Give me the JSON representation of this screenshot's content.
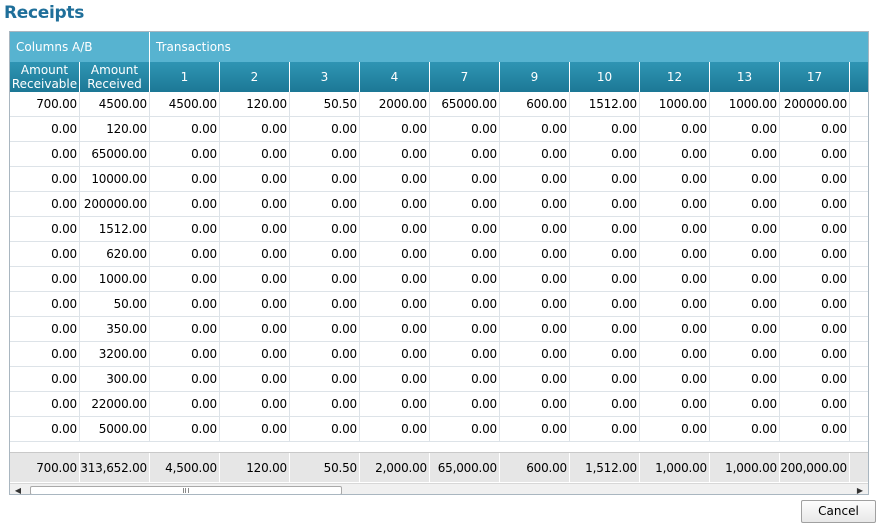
{
  "title": "Receipts",
  "bands": {
    "columns_ab": "Columns A/B",
    "transactions": "Transactions"
  },
  "headers": [
    "Amount Receivable",
    "Amount Received",
    "1",
    "2",
    "3",
    "4",
    "7",
    "9",
    "10",
    "12",
    "13",
    "17"
  ],
  "rows": [
    [
      "700.00",
      "4500.00",
      "4500.00",
      "120.00",
      "50.50",
      "2000.00",
      "65000.00",
      "600.00",
      "1512.00",
      "1000.00",
      "1000.00",
      "200000.00"
    ],
    [
      "0.00",
      "120.00",
      "0.00",
      "0.00",
      "0.00",
      "0.00",
      "0.00",
      "0.00",
      "0.00",
      "0.00",
      "0.00",
      "0.00"
    ],
    [
      "0.00",
      "65000.00",
      "0.00",
      "0.00",
      "0.00",
      "0.00",
      "0.00",
      "0.00",
      "0.00",
      "0.00",
      "0.00",
      "0.00"
    ],
    [
      "0.00",
      "10000.00",
      "0.00",
      "0.00",
      "0.00",
      "0.00",
      "0.00",
      "0.00",
      "0.00",
      "0.00",
      "0.00",
      "0.00"
    ],
    [
      "0.00",
      "200000.00",
      "0.00",
      "0.00",
      "0.00",
      "0.00",
      "0.00",
      "0.00",
      "0.00",
      "0.00",
      "0.00",
      "0.00"
    ],
    [
      "0.00",
      "1512.00",
      "0.00",
      "0.00",
      "0.00",
      "0.00",
      "0.00",
      "0.00",
      "0.00",
      "0.00",
      "0.00",
      "0.00"
    ],
    [
      "0.00",
      "620.00",
      "0.00",
      "0.00",
      "0.00",
      "0.00",
      "0.00",
      "0.00",
      "0.00",
      "0.00",
      "0.00",
      "0.00"
    ],
    [
      "0.00",
      "1000.00",
      "0.00",
      "0.00",
      "0.00",
      "0.00",
      "0.00",
      "0.00",
      "0.00",
      "0.00",
      "0.00",
      "0.00"
    ],
    [
      "0.00",
      "50.00",
      "0.00",
      "0.00",
      "0.00",
      "0.00",
      "0.00",
      "0.00",
      "0.00",
      "0.00",
      "0.00",
      "0.00"
    ],
    [
      "0.00",
      "350.00",
      "0.00",
      "0.00",
      "0.00",
      "0.00",
      "0.00",
      "0.00",
      "0.00",
      "0.00",
      "0.00",
      "0.00"
    ],
    [
      "0.00",
      "3200.00",
      "0.00",
      "0.00",
      "0.00",
      "0.00",
      "0.00",
      "0.00",
      "0.00",
      "0.00",
      "0.00",
      "0.00"
    ],
    [
      "0.00",
      "300.00",
      "0.00",
      "0.00",
      "0.00",
      "0.00",
      "0.00",
      "0.00",
      "0.00",
      "0.00",
      "0.00",
      "0.00"
    ],
    [
      "0.00",
      "22000.00",
      "0.00",
      "0.00",
      "0.00",
      "0.00",
      "0.00",
      "0.00",
      "0.00",
      "0.00",
      "0.00",
      "0.00"
    ],
    [
      "0.00",
      "5000.00",
      "0.00",
      "0.00",
      "0.00",
      "0.00",
      "0.00",
      "0.00",
      "0.00",
      "0.00",
      "0.00",
      "0.00"
    ]
  ],
  "totals": [
    "700.00",
    "313,652.00",
    "4,500.00",
    "120.00",
    "50.50",
    "2,000.00",
    "65,000.00",
    "600.00",
    "1,512.00",
    "1,000.00",
    "1,000.00",
    "200,000.00"
  ],
  "scrollbar": {
    "left_arrow": "◀",
    "right_arrow": "▶"
  },
  "cancel_label": "Cancel",
  "colors": {
    "title": "#1f6f9a",
    "band": "#57b3d0",
    "header": "#1c7896",
    "totals_bg": "#e6e6e6"
  }
}
